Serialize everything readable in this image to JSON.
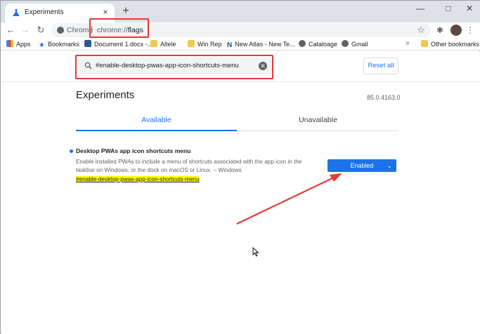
{
  "tab": {
    "title": "Experiments",
    "close": "×",
    "new_tab": "+"
  },
  "window_controls": {
    "minimize": "—",
    "maximize": "□",
    "close": "✕"
  },
  "omnibox": {
    "scheme_label": "Chrome",
    "separator": "|",
    "url_host": "chrome://",
    "url_path": "flags"
  },
  "bookmarks": [
    {
      "label": "Apps",
      "icon": "apps-icon"
    },
    {
      "label": "Bookmarks",
      "icon": "star-icon"
    },
    {
      "label": "Document 1.docx -...",
      "icon": "word-icon"
    },
    {
      "label": "Altele",
      "icon": "folder-icon"
    },
    {
      "label": "Win Rep",
      "icon": "folder-icon"
    },
    {
      "label": "New Atlas - New Te...",
      "icon": "n-icon"
    },
    {
      "label": "Cataloage",
      "icon": "globe-icon"
    },
    {
      "label": "Gmail",
      "icon": "globe-icon"
    },
    {
      "label": "Other bookmarks",
      "icon": "folder-icon"
    }
  ],
  "bookmarks_overflow": "»",
  "search": {
    "value": "#enable-desktop-pwas-app-icon-shortcuts-menu"
  },
  "reset_label": "Reset all",
  "page_title": "Experiments",
  "version": "85.0.4163.0",
  "tabs": {
    "available": "Available",
    "unavailable": "Unavailable"
  },
  "flag": {
    "title": "Desktop PWAs app icon shortcuts menu",
    "description": "Enable installed PWAs to include a menu of shortcuts associated with the app icon in the taskbar on Windows, or the dock on macOS or Linux. – Windows",
    "link": "#enable-desktop-pwas-app-icon-shortcuts-menu",
    "selected": "Enabled"
  },
  "colors": {
    "accent": "#1a73e8",
    "highlight": "#ffff00",
    "annotation": "#e53935"
  }
}
